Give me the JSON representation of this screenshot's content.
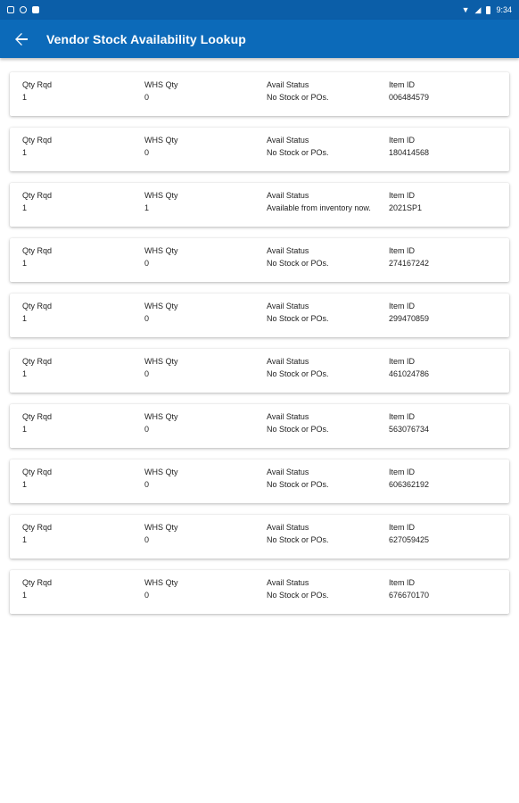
{
  "status_bar": {
    "time": "9:34"
  },
  "header": {
    "title": "Vendor Stock Availability Lookup",
    "back_icon": "arrow-left-icon"
  },
  "columns": {
    "qty_rqd": "Qty Rqd",
    "whs_qty": "WHS Qty",
    "avail_status": "Avail Status",
    "item_id": "Item  ID"
  },
  "items": [
    {
      "qty_rqd": "1",
      "whs_qty": "0",
      "avail_status": "No Stock or POs.",
      "item_id": "006484579"
    },
    {
      "qty_rqd": "1",
      "whs_qty": "0",
      "avail_status": "No Stock or POs.",
      "item_id": "180414568"
    },
    {
      "qty_rqd": "1",
      "whs_qty": "1",
      "avail_status": "Available from inventory now.",
      "item_id": "2021SP1"
    },
    {
      "qty_rqd": "1",
      "whs_qty": "0",
      "avail_status": "No Stock or POs.",
      "item_id": "274167242"
    },
    {
      "qty_rqd": "1",
      "whs_qty": "0",
      "avail_status": "No Stock or POs.",
      "item_id": "299470859"
    },
    {
      "qty_rqd": "1",
      "whs_qty": "0",
      "avail_status": "No Stock or POs.",
      "item_id": "461024786"
    },
    {
      "qty_rqd": "1",
      "whs_qty": "0",
      "avail_status": "No Stock or POs.",
      "item_id": "563076734"
    },
    {
      "qty_rqd": "1",
      "whs_qty": "0",
      "avail_status": "No Stock or POs.",
      "item_id": "606362192"
    },
    {
      "qty_rqd": "1",
      "whs_qty": "0",
      "avail_status": "No Stock or POs.",
      "item_id": "627059425"
    },
    {
      "qty_rqd": "1",
      "whs_qty": "0",
      "avail_status": "No Stock or POs.",
      "item_id": "676670170"
    }
  ]
}
